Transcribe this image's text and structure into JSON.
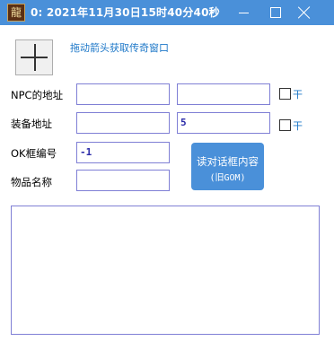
{
  "window": {
    "app_icon_glyph": "龍",
    "title": "0:  2021年11月30日15时40分40秒"
  },
  "picker": {
    "hint": "拖动箭头获取传奇窗口"
  },
  "form": {
    "npc_label": "NPC的地址",
    "npc_value1": "",
    "npc_value2": "",
    "npc_check_label": "干",
    "equip_label": "装备地址",
    "equip_value1": "",
    "equip_value2": "5",
    "equip_check_label": "干",
    "ok_label": "OK框编号",
    "ok_value": "-1",
    "item_label": "物品名称",
    "item_value": ""
  },
  "read_button": {
    "line1": "读对话框内容",
    "line2": "(旧GOM)"
  },
  "output": {
    "text": ""
  },
  "colors": {
    "titlebar": "#4a90d9",
    "accent_text": "#1e78c8",
    "field_border": "#7f7fd5",
    "field_text": "#2a2aa8"
  }
}
